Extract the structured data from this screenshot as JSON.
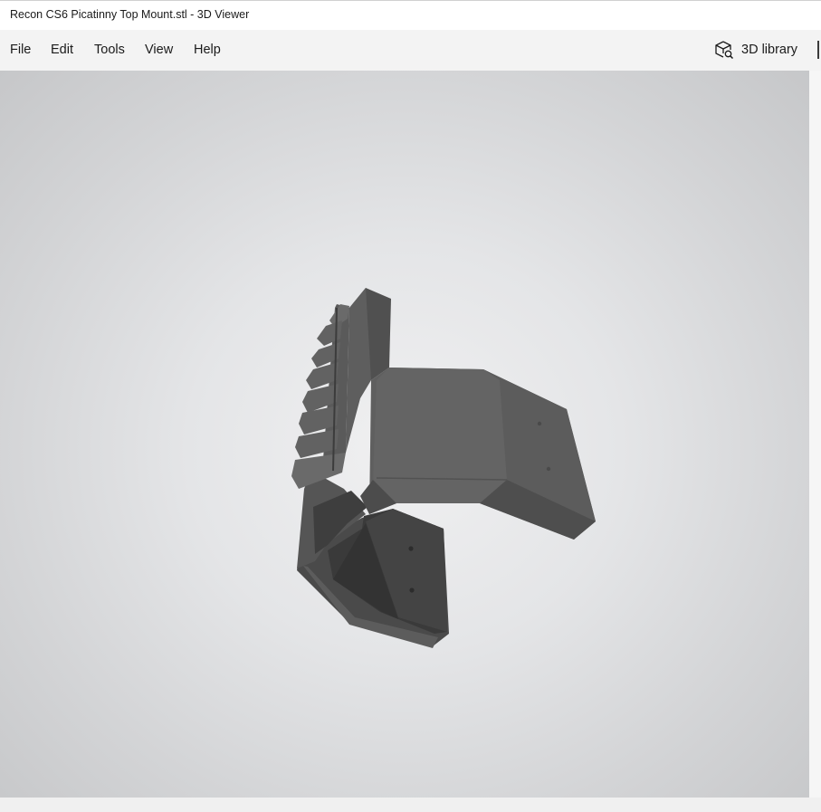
{
  "window": {
    "title": "Recon CS6 Picatinny Top Mount.stl - 3D Viewer"
  },
  "menu": {
    "items": [
      "File",
      "Edit",
      "Tools",
      "View",
      "Help"
    ],
    "library_label": "3D library",
    "library_icon": "cube-search-icon"
  },
  "viewport": {
    "model_name": "Recon CS6 Picatinny Top Mount.stl",
    "model_color": "#5a5a5a"
  }
}
